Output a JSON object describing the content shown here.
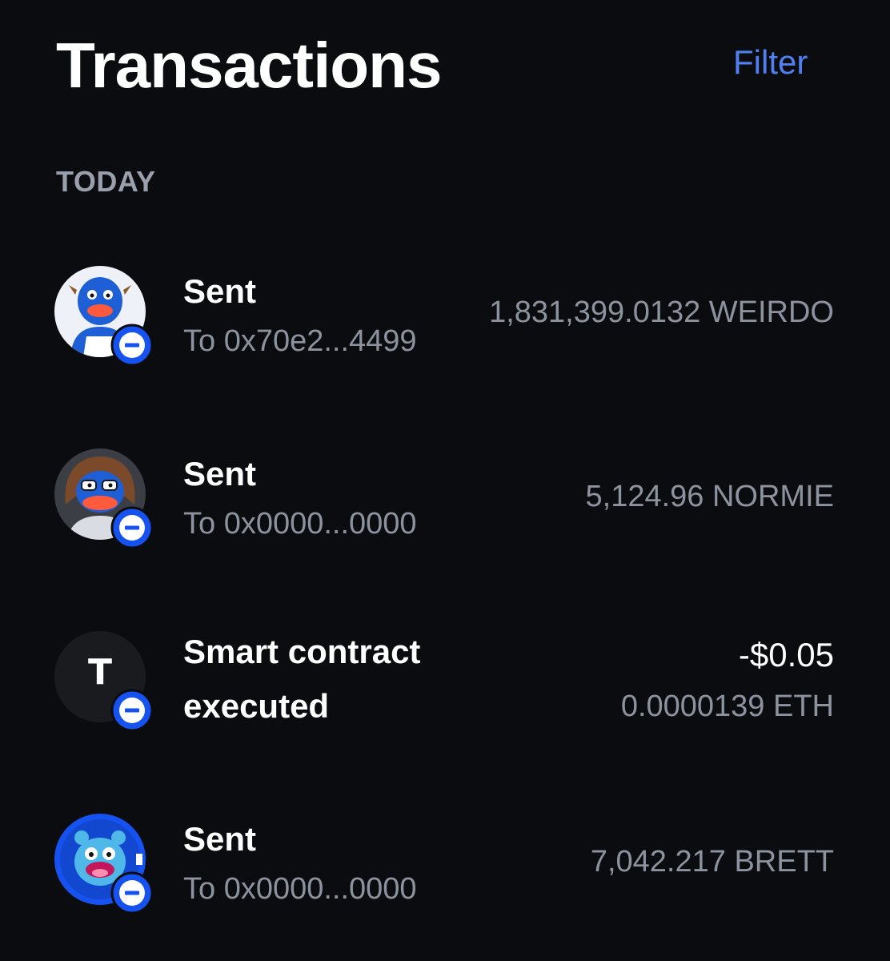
{
  "header": {
    "title": "Transactions",
    "filter_label": "Filter"
  },
  "section_label": "TODAY",
  "transactions": [
    {
      "label": "Sent",
      "subtitle": "To 0x70e2...4499",
      "amount": "1,831,399.0132 WEIRDO",
      "avatar_icon": "weirdo-token-icon",
      "badge_icon": "minus-circle-icon"
    },
    {
      "label": "Sent",
      "subtitle": "To 0x0000...0000",
      "amount": "5,124.96 NORMIE",
      "avatar_icon": "normie-token-icon",
      "badge_icon": "minus-circle-icon"
    },
    {
      "label_line1": "Smart contract",
      "label_line2": "executed",
      "amount_fiat": "-$0.05",
      "amount": "0.0000139 ETH",
      "avatar_icon": "smart-contract-icon",
      "avatar_glyph": "T",
      "badge_icon": "minus-circle-icon"
    },
    {
      "label": "Sent",
      "subtitle": "To 0x0000...0000",
      "amount": "7,042.217 BRETT",
      "avatar_icon": "brett-token-icon",
      "badge_icon": "minus-circle-icon"
    }
  ],
  "colors": {
    "background": "#0b0c0f",
    "accent": "#4f7ff0",
    "badge_blue": "#1652f0",
    "secondary_text": "#8d939e"
  }
}
